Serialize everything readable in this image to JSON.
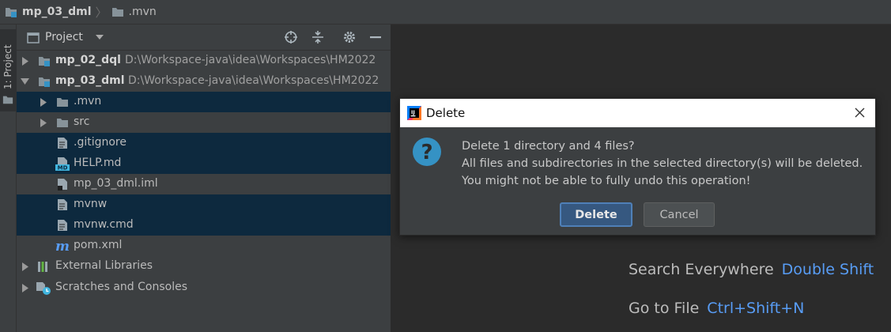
{
  "breadcrumb": {
    "project": "mp_03_dml",
    "folder": ".mvn"
  },
  "toolstrip": {
    "project_tab": "1: Project"
  },
  "project_panel": {
    "title": "Project",
    "tree": [
      {
        "label": "mp_02_dql",
        "path": "D:\\Workspace-java\\idea\\Workspaces\\HM2022"
      },
      {
        "label": "mp_03_dml",
        "path": "D:\\Workspace-java\\idea\\Workspaces\\HM2022"
      },
      {
        "label": ".mvn"
      },
      {
        "label": "src"
      },
      {
        "label": ".gitignore"
      },
      {
        "label": "HELP.md"
      },
      {
        "label": "mp_03_dml.iml"
      },
      {
        "label": "mvnw"
      },
      {
        "label": "mvnw.cmd"
      },
      {
        "label": "pom.xml"
      },
      {
        "label": "External Libraries"
      },
      {
        "label": "Scratches and Consoles"
      }
    ]
  },
  "editor_hints": {
    "search_label": "Search Everywhere",
    "search_key": "Double Shift",
    "goto_label": "Go to File",
    "goto_key": "Ctrl+Shift+N"
  },
  "dialog": {
    "title": "Delete",
    "line1": "Delete 1 directory and 4 files?",
    "line2": "All files and subdirectories in the selected directory(s) will be deleted.",
    "line3": "You might not be able to fully undo this operation!",
    "primary_button": "Delete",
    "secondary_button": "Cancel"
  },
  "colors": {
    "selection": "#0d293e",
    "folder": "#87939a",
    "accent_blue": "#589df6",
    "dialog_primary": "#365880",
    "question_icon": "#3592c4"
  }
}
